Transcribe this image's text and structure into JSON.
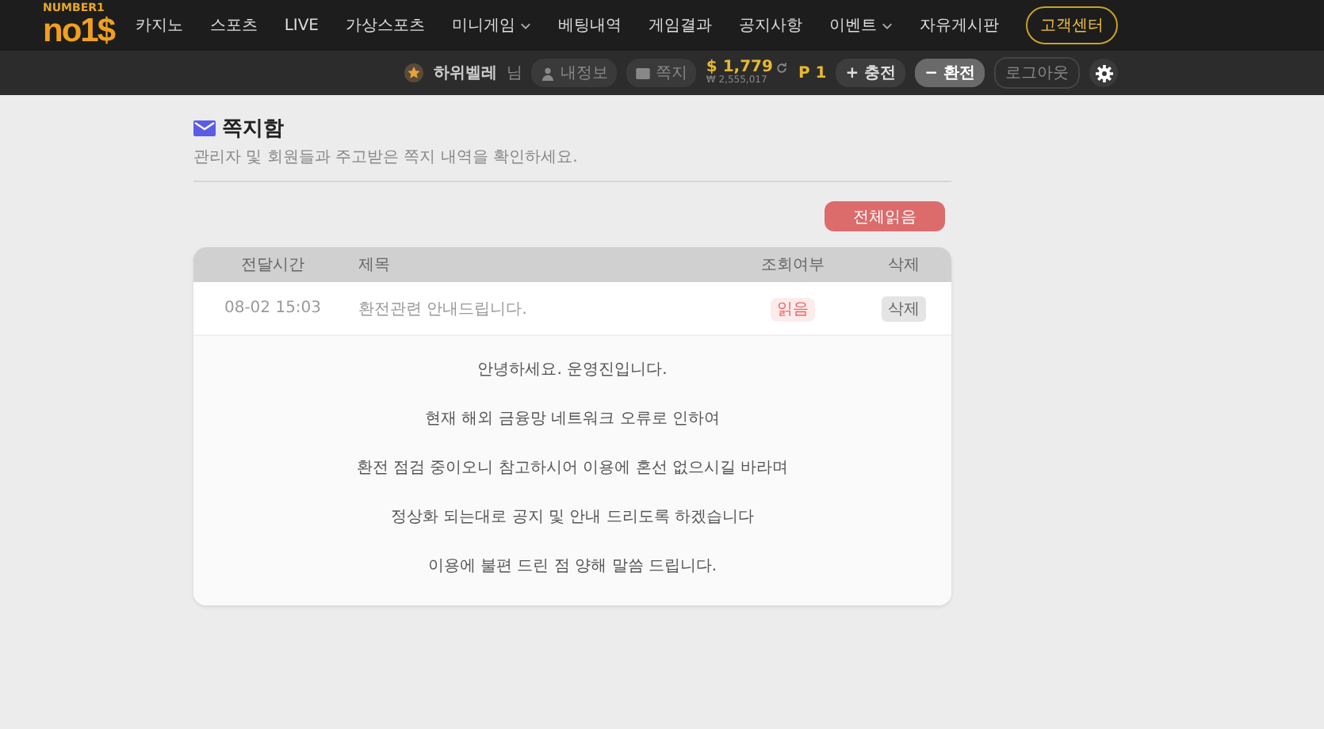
{
  "logo": {
    "top": "NUMBER1",
    "main": "no1$"
  },
  "nav": [
    {
      "label": "카지노",
      "caret": false
    },
    {
      "label": "스포츠",
      "caret": false
    },
    {
      "label": "LIVE",
      "caret": false
    },
    {
      "label": "가상스포츠",
      "caret": false
    },
    {
      "label": "미니게임",
      "caret": true
    },
    {
      "label": "베팅내역",
      "caret": false
    },
    {
      "label": "게임결과",
      "caret": false
    },
    {
      "label": "공지사항",
      "caret": false
    },
    {
      "label": "이벤트",
      "caret": true
    },
    {
      "label": "자유게시판",
      "caret": false
    }
  ],
  "support_button": "고객센터",
  "user_bar": {
    "username": "하위벨레",
    "suffix": "님",
    "my_info": "내정보",
    "messages": "쪽지",
    "balance": "$ 1,779",
    "balance_krw": "₩ 2,555,017",
    "points_mark": "P",
    "points": "1",
    "deposit": "+ 충전",
    "withdraw": "− 환전",
    "logout": "로그아웃"
  },
  "page": {
    "title": "쪽지함",
    "subtitle": "관리자 및 회원들과 주고받은 쪽지 내역을 확인하세요.",
    "read_all": "전체읽음"
  },
  "table": {
    "columns": [
      "전달시간",
      "제목",
      "조회여부",
      "삭제"
    ],
    "rows": [
      {
        "time": "08-02 15:03",
        "subject": "환전관련 안내드립니다.",
        "status": "읽음",
        "delete": "삭제",
        "expanded": true,
        "body": [
          "안녕하세요. 운영진입니다.",
          "현재 해외 금융망 네트워크 오류로 인하여",
          "환전 점검 중이오니 참고하시어 이용에 혼선 없으시길 바라며",
          "정상화 되는대로 공지 및 안내 드리도록 하겠습니다",
          "이용에 불편 드린 점 양해 말씀 드립니다."
        ]
      }
    ]
  }
}
